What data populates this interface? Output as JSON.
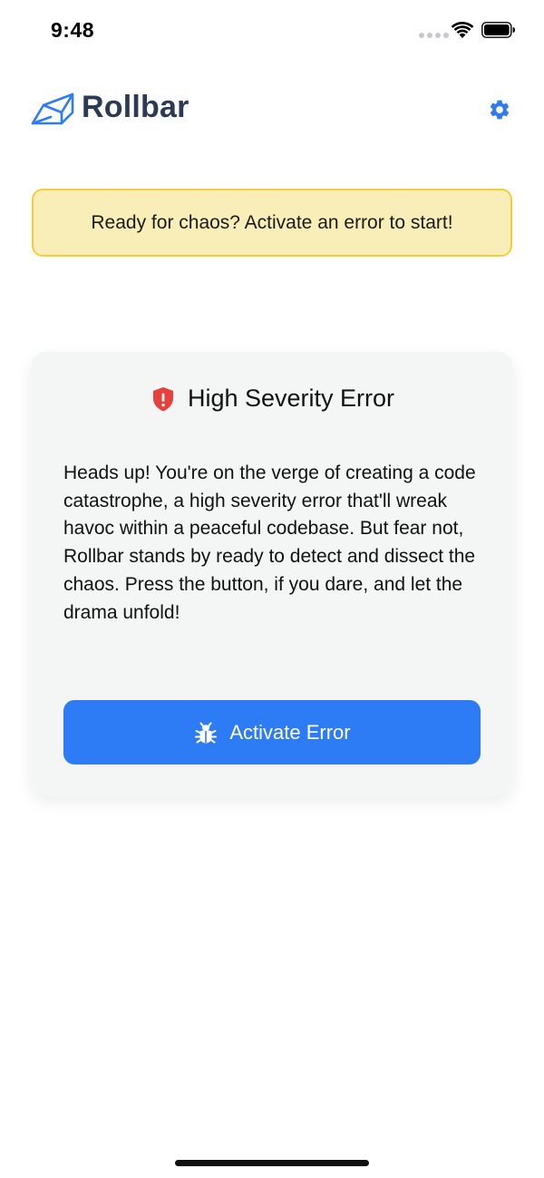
{
  "status_bar": {
    "time": "9:48"
  },
  "header": {
    "brand_name": "Rollbar",
    "logo_icon": "rollbar-logo-icon",
    "settings_icon": "gear-icon"
  },
  "banner": {
    "text": "Ready for chaos? Activate an error to start!"
  },
  "card": {
    "icon": "shield-exclamation-icon",
    "title": "High Severity Error",
    "description": "Heads up! You're on the verge of creating a code catastrophe, a high severity error that'll wreak havoc within a peaceful codebase. But fear not, Rollbar stands by ready to detect and dissect the chaos. Press the button, if you dare, and let the drama unfold!",
    "button": {
      "icon": "bug-icon",
      "label": "Activate Error"
    }
  },
  "colors": {
    "accent": "#2d7bf5",
    "brand_text": "#2b3a55",
    "banner_bg": "#f9edb8",
    "banner_border": "#f0cf3a",
    "danger": "#e8403a",
    "card_bg": "#f4f5f5"
  }
}
